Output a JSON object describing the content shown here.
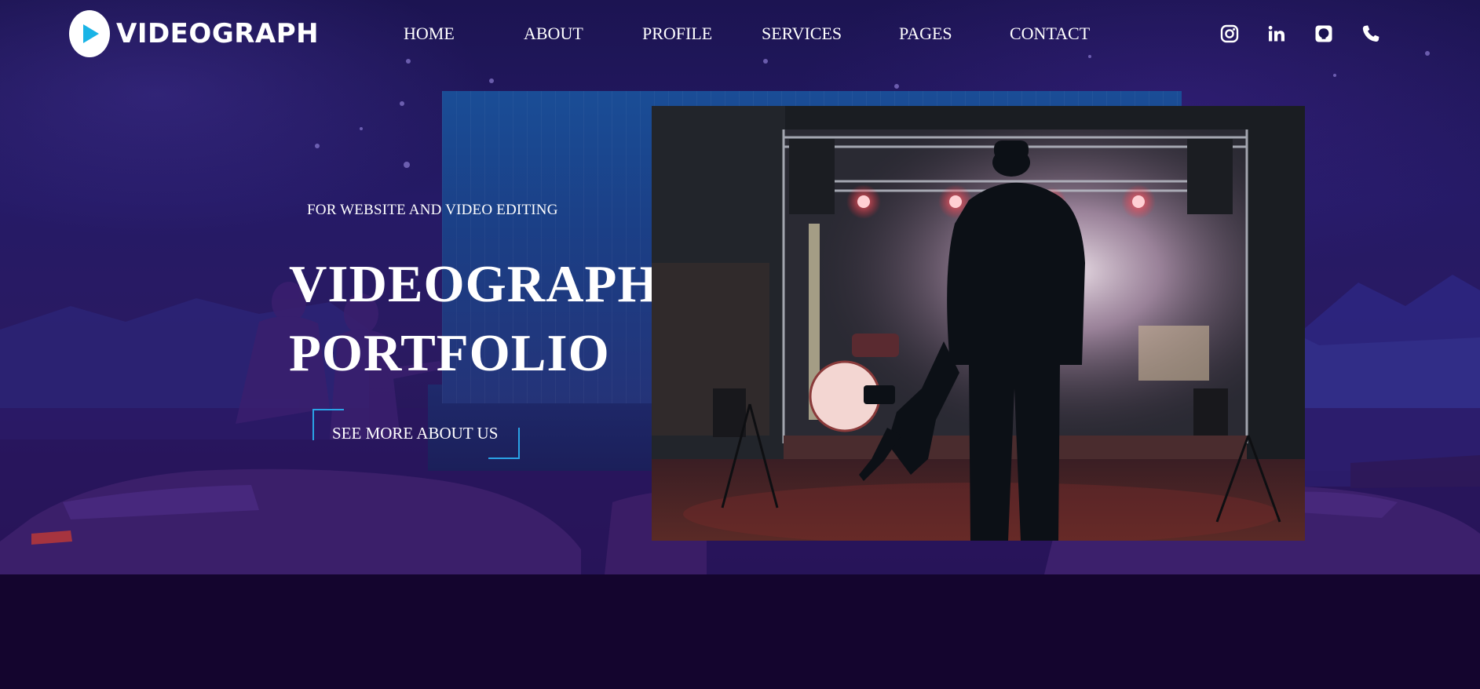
{
  "brand": {
    "name": "VIDEOGRAPH",
    "logo_icon": "play-icon",
    "accent_color": "#1ab4e6"
  },
  "nav": {
    "items": [
      {
        "label": "HOME"
      },
      {
        "label": "ABOUT"
      },
      {
        "label": "PROFILE"
      },
      {
        "label": "SERVICES"
      },
      {
        "label": "PAGES"
      },
      {
        "label": "CONTACT"
      }
    ]
  },
  "social": [
    {
      "icon": "instagram-icon"
    },
    {
      "icon": "linkedin-icon"
    },
    {
      "icon": "github-icon"
    },
    {
      "icon": "phone-icon"
    }
  ],
  "hero": {
    "subtitle": "FOR WEBSITE AND VIDEO EDITING",
    "title_line1": "VIDEOGRAPHER’S",
    "title_line2": "PORTFOLIO",
    "cta_label": "SEE MORE ABOUT US",
    "cta_accent": "#2aa3e6",
    "background_color": "#14052e"
  }
}
